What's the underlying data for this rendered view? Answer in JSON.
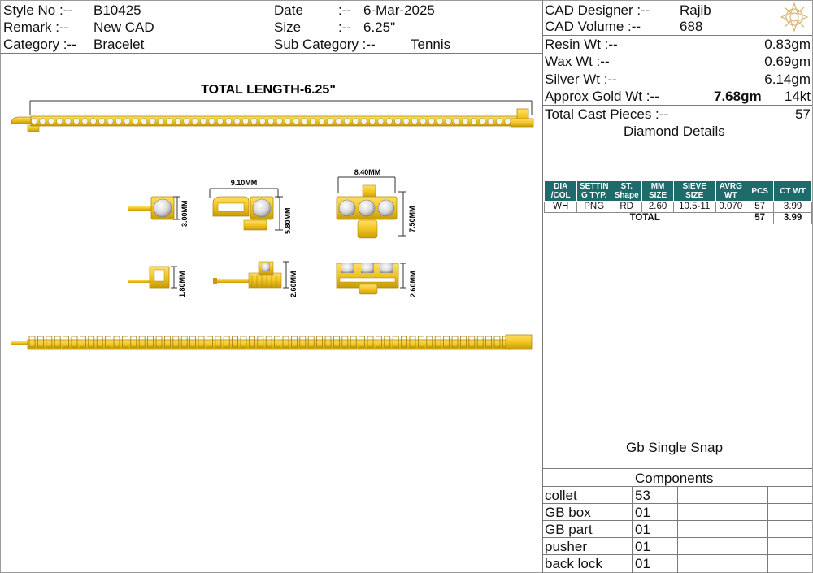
{
  "header": {
    "style_no_label": "Style No :--",
    "style_no": "B10425",
    "remark_label": "Remark  :--",
    "remark": "New CAD",
    "category_label": "Category :--",
    "category": "Bracelet",
    "date_label": "Date",
    "date_sep": ":--",
    "date": "6-Mar-2025",
    "size_label": "Size",
    "size_sep": ":--",
    "size": "6.25\"",
    "subcat_label": "Sub Category :--",
    "subcat": "Tennis"
  },
  "cad": {
    "designer_label": "CAD   Designer :--",
    "designer": "Rajib",
    "volume_label": "CAD   Volume  :--",
    "volume": "688"
  },
  "weights": {
    "resin_label": "Resin Wt :--",
    "resin": "0.83gm",
    "wax_label": "Wax   Wt :--",
    "wax": "0.69gm",
    "silver_label": "Silver Wt :--",
    "silver": "6.14gm",
    "gold_label": "Approx Gold Wt :--",
    "gold": "7.68gm",
    "karat": "14kt",
    "cast_label": "Total Cast Pieces :--",
    "cast": "57"
  },
  "diamond": {
    "title": "Diamond Details",
    "headers": [
      "DIA /COL",
      "SETTIN G TYP.",
      "ST. Shape",
      "MM SIZE",
      "SIEVE SIZE",
      "AVRG WT",
      "PCS",
      "CT WT"
    ],
    "row": [
      "WH",
      "PNG",
      "RD",
      "2.60",
      "10.5-11",
      "0.070",
      "57",
      "3.99"
    ],
    "total_label": "TOTAL",
    "total_pcs": "57",
    "total_ct": "3.99"
  },
  "lock_type": "Gb Single Snap",
  "components": {
    "title": "Components",
    "items": [
      {
        "name": "collet",
        "qty": "53"
      },
      {
        "name": "GB box",
        "qty": "01"
      },
      {
        "name": "GB part",
        "qty": "01"
      },
      {
        "name": "pusher",
        "qty": "01"
      },
      {
        "name": "back lock",
        "qty": "01"
      }
    ]
  },
  "drawing": {
    "total_length": "TOTAL LENGTH-6.25\"",
    "dim_single_h": "3.00MM",
    "dim_clasp_w": "9.10MM",
    "dim_clasp_h": "5.80MM",
    "dim_box_w": "8.40MM",
    "dim_box_h": "7.50MM",
    "dim_side1": "1.80MM",
    "dim_side2": "2.60MM",
    "dim_side3": "2.60MM"
  },
  "colors": {
    "gold": "#f0c420",
    "gold_dark": "#c79a0a",
    "table_header": "#1d6b6b"
  },
  "icons": {
    "logo": "ornament-logo-icon"
  }
}
